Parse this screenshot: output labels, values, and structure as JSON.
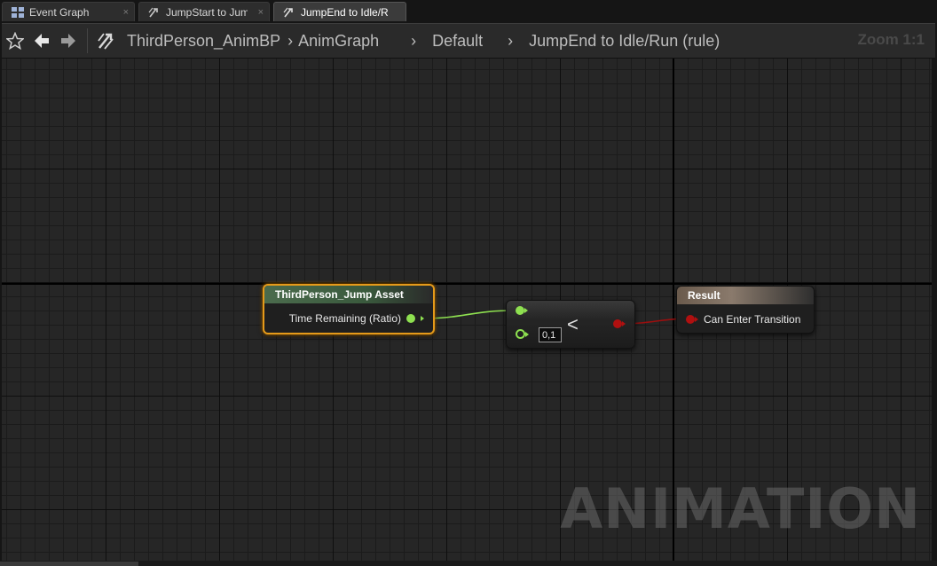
{
  "tabs": [
    {
      "label": "Event Graph",
      "icon": "event-graph-icon",
      "active": false
    },
    {
      "label": "JumpStart to Jump",
      "icon": "transition-rule-icon",
      "active": false
    },
    {
      "label": "JumpEnd to Idle/R",
      "icon": "transition-rule-icon",
      "active": true
    }
  ],
  "tab_close_glyph": "×",
  "navbar": {
    "breadcrumbs": [
      "ThirdPerson_AnimBP",
      "AnimGraph",
      "Default",
      "JumpEnd to Idle/Run (rule)"
    ],
    "zoom": "Zoom 1:1"
  },
  "graph": {
    "watermark": "ANIMATION",
    "asset_node": {
      "title": "ThirdPerson_Jump Asset",
      "output_pin": "Time Remaining (Ratio)"
    },
    "compare_node": {
      "operator": "<",
      "b_value": "0,1"
    },
    "result_node": {
      "title": "Result",
      "input_pin": "Can Enter Transition"
    }
  },
  "colors": {
    "accent_selected": "#e59a1a",
    "float_pin": "#8ee050",
    "bool_pin": "#b01010"
  }
}
